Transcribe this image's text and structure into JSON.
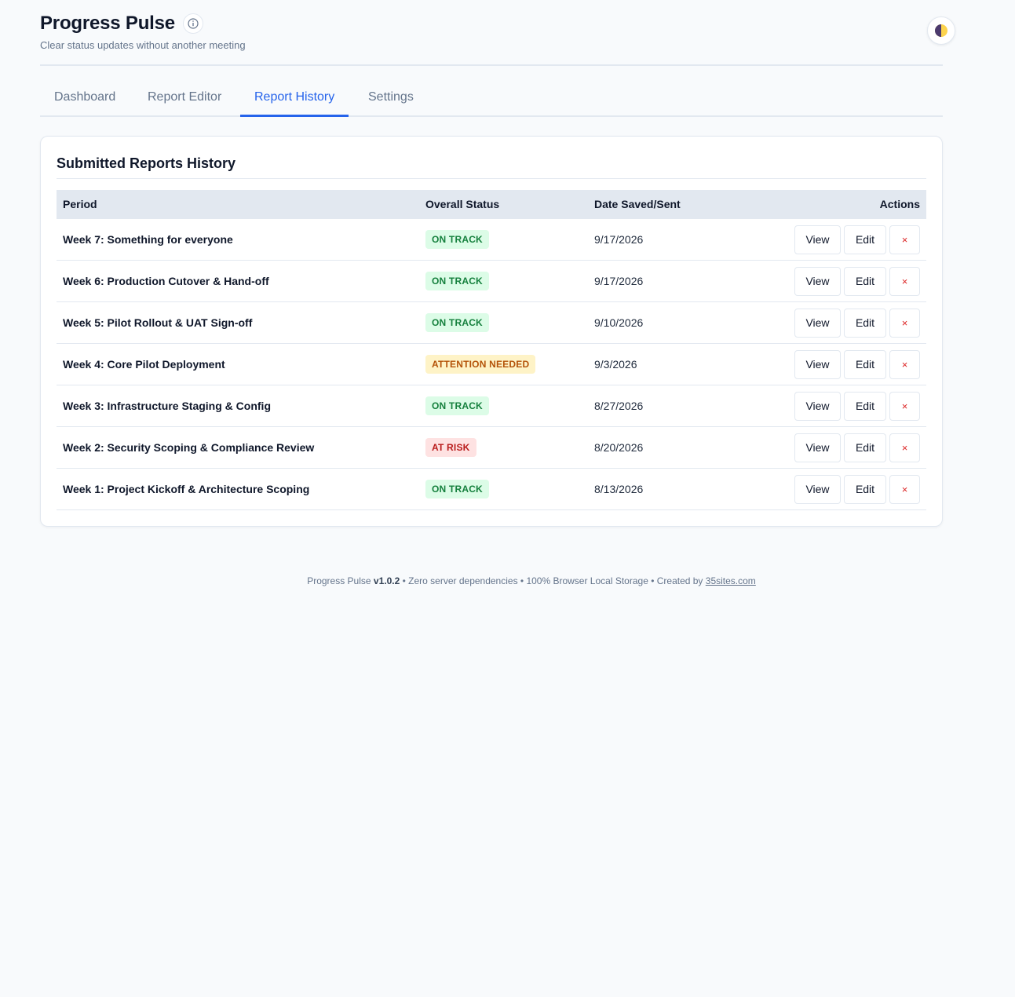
{
  "header": {
    "title": "Progress Pulse",
    "subtitle": "Clear status updates without another meeting",
    "info_icon": "info-icon",
    "theme_icon": "half-moon-icon"
  },
  "tabs": [
    {
      "label": "Dashboard",
      "active": false
    },
    {
      "label": "Report Editor",
      "active": false
    },
    {
      "label": "Report History",
      "active": true
    },
    {
      "label": "Settings",
      "active": false
    }
  ],
  "history": {
    "title": "Submitted Reports History",
    "columns": {
      "period": "Period",
      "status": "Overall Status",
      "date": "Date Saved/Sent",
      "actions": "Actions"
    },
    "buttons": {
      "view": "View",
      "edit": "Edit",
      "delete": "×"
    },
    "rows": [
      {
        "period": "Week 7: Something for everyone",
        "status": "ON TRACK",
        "status_kind": "on",
        "date": "9/17/2026"
      },
      {
        "period": "Week 6: Production Cutover & Hand-off",
        "status": "ON TRACK",
        "status_kind": "on",
        "date": "9/17/2026"
      },
      {
        "period": "Week 5: Pilot Rollout & UAT Sign-off",
        "status": "ON TRACK",
        "status_kind": "on",
        "date": "9/10/2026"
      },
      {
        "period": "Week 4: Core Pilot Deployment",
        "status": "ATTENTION NEEDED",
        "status_kind": "att",
        "date": "9/3/2026"
      },
      {
        "period": "Week 3: Infrastructure Staging & Config",
        "status": "ON TRACK",
        "status_kind": "on",
        "date": "8/27/2026"
      },
      {
        "period": "Week 2: Security Scoping & Compliance Review",
        "status": "AT RISK",
        "status_kind": "risk",
        "date": "8/20/2026"
      },
      {
        "period": "Week 1: Project Kickoff & Architecture Scoping",
        "status": "ON TRACK",
        "status_kind": "on",
        "date": "8/13/2026"
      }
    ]
  },
  "footer": {
    "app_name": "Progress Pulse",
    "version": "v1.0.2",
    "text": "• Zero server dependencies • 100% Browser Local Storage • Created by",
    "link": "35sites.com"
  },
  "colors": {
    "accent": "#2563eb",
    "on_track_bg": "#dcfce7",
    "on_track_fg": "#15803d",
    "attention_bg": "#fef3c7",
    "attention_fg": "#b45309",
    "at_risk_bg": "#fee2e2",
    "at_risk_fg": "#b91c1c"
  }
}
